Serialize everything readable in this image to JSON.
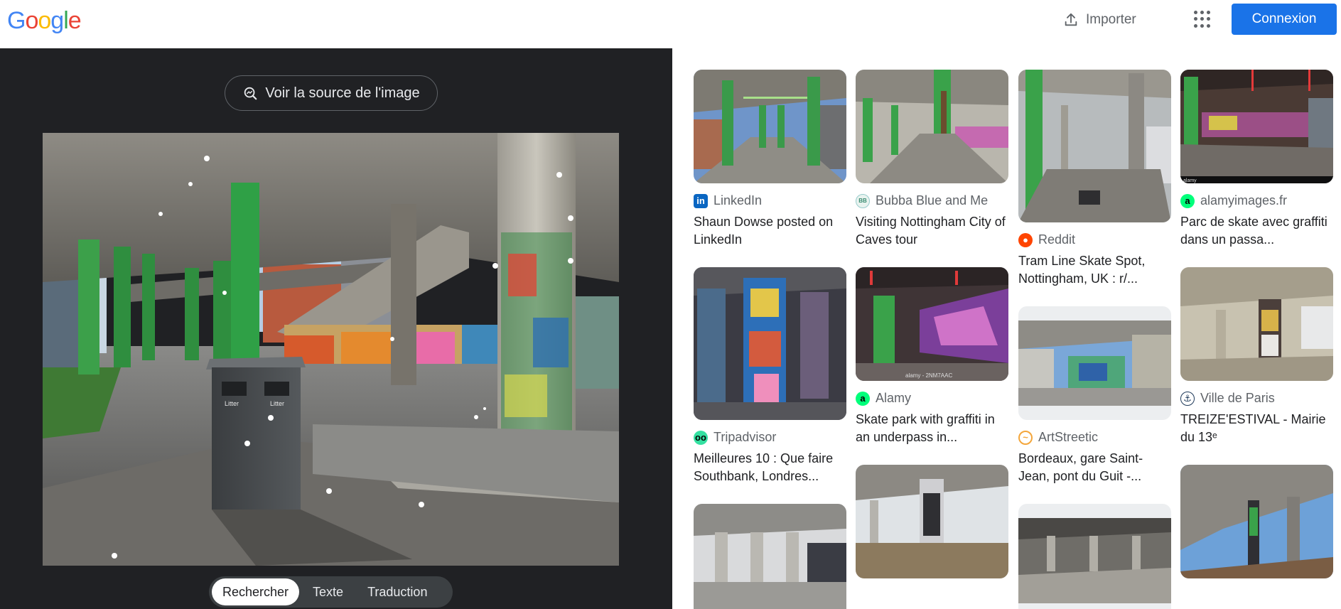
{
  "header": {
    "logo_letters": [
      "G",
      "o",
      "o",
      "g",
      "l",
      "e"
    ],
    "logo_colors": [
      "#4285F4",
      "#EA4335",
      "#FBBC05",
      "#4285F4",
      "#34A853",
      "#EA4335"
    ],
    "import_label": "Importer",
    "login_label": "Connexion"
  },
  "viewer": {
    "source_button_label": "Voir la source de l'image",
    "bin_label_1": "Litter",
    "bin_label_2": "Litter",
    "tabs": [
      {
        "label": "Rechercher",
        "active": true
      },
      {
        "label": "Texte",
        "active": false
      },
      {
        "label": "Traduction",
        "active": false
      }
    ]
  },
  "results": {
    "col1": [
      {
        "source": "LinkedIn",
        "title": "Shaun Dowse posted on LinkedIn",
        "favicon": "linkedin-icon"
      },
      {
        "source": "Tripadvisor",
        "title": "Meilleures 10 : Que faire Southbank, Londres...",
        "favicon": "tripadvisor-icon"
      }
    ],
    "col2": [
      {
        "source": "Bubba Blue and Me",
        "title": "Visiting Nottingham City of Caves tour",
        "favicon": "bubba-blue-icon"
      },
      {
        "source": "Alamy",
        "title": "Skate park with graffiti in an underpass in...",
        "favicon": "alamy-icon",
        "watermark": "alamy - 2NM7AAC"
      }
    ],
    "col3": [
      {
        "source": "Reddit",
        "title": "Tram Line Skate Spot, Nottingham, UK : r/...",
        "favicon": "reddit-icon"
      },
      {
        "source": "ArtStreetic",
        "title": "Bordeaux, gare Saint-Jean, pont du Guit -...",
        "favicon": "artstreetic-icon"
      }
    ],
    "col4": [
      {
        "source": "alamyimages.fr",
        "title": "Parc de skate avec graffiti dans un passa...",
        "favicon": "alamy-icon",
        "watermark": "alamy"
      },
      {
        "source": "Ville de Paris",
        "title": "TREIZE'ESTIVAL - Mairie du 13ᵉ",
        "favicon": "ville-de-paris-icon"
      }
    ]
  }
}
